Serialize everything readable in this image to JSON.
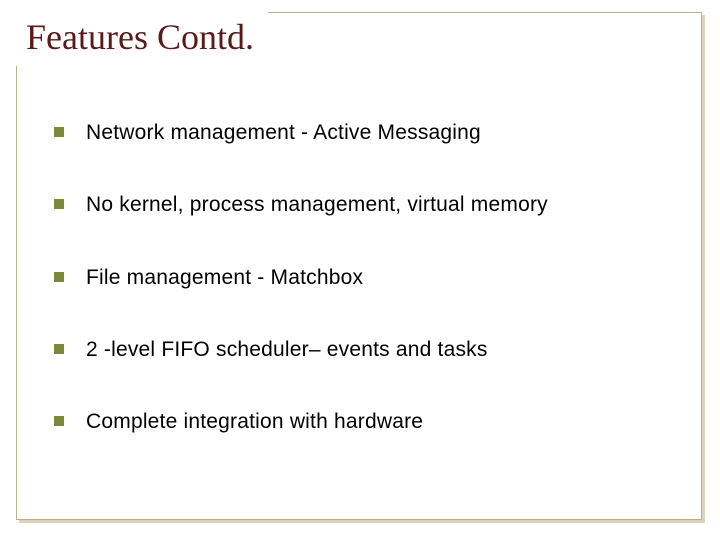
{
  "slide": {
    "title": "Features Contd.",
    "bullets": [
      "Network management - Active Messaging",
      "No kernel, process management, virtual memory",
      "File management - Matchbox",
      "2 -level FIFO scheduler– events and tasks",
      "Complete integration with hardware"
    ]
  },
  "colors": {
    "title": "#5a1a1a",
    "bullet": "#7a8a3a",
    "frame": "#b9b18a"
  }
}
